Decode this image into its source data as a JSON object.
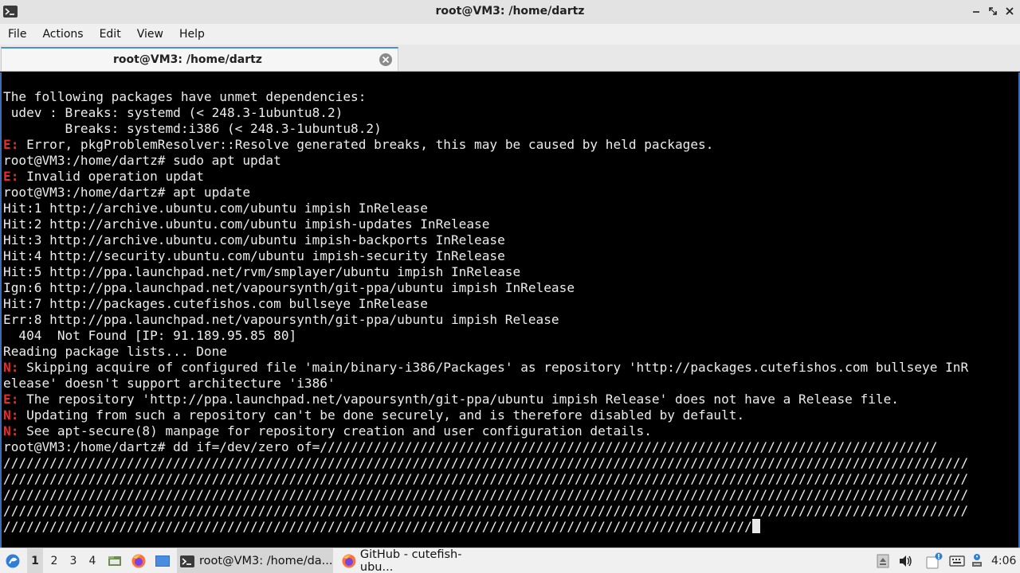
{
  "window": {
    "title": "root@VM3: /home/dartz"
  },
  "menu": {
    "items": [
      "File",
      "Actions",
      "Edit",
      "View",
      "Help"
    ]
  },
  "tab": {
    "label": "root@VM3: /home/dartz"
  },
  "terminal": {
    "lines": [
      {
        "pfx": "",
        "text": "The following packages have unmet dependencies:"
      },
      {
        "pfx": "",
        "text": " udev : Breaks: systemd (< 248.3-1ubuntu8.2)"
      },
      {
        "pfx": "",
        "text": "        Breaks: systemd:i386 (< 248.3-1ubuntu8.2)"
      },
      {
        "pfx": "E:",
        "text": " Error, pkgProblemResolver::Resolve generated breaks, this may be caused by held packages."
      },
      {
        "pfx": "",
        "text": "root@VM3:/home/dartz# sudo apt updat"
      },
      {
        "pfx": "E:",
        "text": " Invalid operation updat"
      },
      {
        "pfx": "",
        "text": "root@VM3:/home/dartz# apt update"
      },
      {
        "pfx": "",
        "text": "Hit:1 http://archive.ubuntu.com/ubuntu impish InRelease"
      },
      {
        "pfx": "",
        "text": "Hit:2 http://archive.ubuntu.com/ubuntu impish-updates InRelease"
      },
      {
        "pfx": "",
        "text": "Hit:3 http://archive.ubuntu.com/ubuntu impish-backports InRelease"
      },
      {
        "pfx": "",
        "text": "Hit:4 http://security.ubuntu.com/ubuntu impish-security InRelease"
      },
      {
        "pfx": "",
        "text": "Hit:5 http://ppa.launchpad.net/rvm/smplayer/ubuntu impish InRelease"
      },
      {
        "pfx": "",
        "text": "Ign:6 http://ppa.launchpad.net/vapoursynth/git-ppa/ubuntu impish InRelease"
      },
      {
        "pfx": "",
        "text": "Hit:7 http://packages.cutefishos.com bullseye InRelease"
      },
      {
        "pfx": "",
        "text": "Err:8 http://ppa.launchpad.net/vapoursynth/git-ppa/ubuntu impish Release"
      },
      {
        "pfx": "",
        "text": "  404  Not Found [IP: 91.189.95.85 80]"
      },
      {
        "pfx": "",
        "text": "Reading package lists... Done"
      },
      {
        "pfx": "N:",
        "text": " Skipping acquire of configured file 'main/binary-i386/Packages' as repository 'http://packages.cutefishos.com bullseye InR"
      },
      {
        "pfx": "",
        "text": "elease' doesn't support architecture 'i386'"
      },
      {
        "pfx": "E:",
        "text": " The repository 'http://ppa.launchpad.net/vapoursynth/git-ppa/ubuntu impish Release' does not have a Release file."
      },
      {
        "pfx": "N:",
        "text": " Updating from such a repository can't be done securely, and is therefore disabled by default."
      },
      {
        "pfx": "N:",
        "text": " See apt-secure(8) manpage for repository creation and user configuration details."
      },
      {
        "pfx": "",
        "text": "root@VM3:/home/dartz# dd if=/dev/zero of=////////////////////////////////////////////////////////////////////////////////"
      },
      {
        "pfx": "",
        "text": "/////////////////////////////////////////////////////////////////////////////////////////////////////////////////////////////"
      },
      {
        "pfx": "",
        "text": "/////////////////////////////////////////////////////////////////////////////////////////////////////////////////////////////"
      },
      {
        "pfx": "",
        "text": "/////////////////////////////////////////////////////////////////////////////////////////////////////////////////////////////"
      },
      {
        "pfx": "",
        "text": "/////////////////////////////////////////////////////////////////////////////////////////////////////////////////////////////"
      },
      {
        "pfx": "",
        "text": "/////////////////////////////////////////////////////////////////////////////////////////////////",
        "cursor": true
      }
    ]
  },
  "taskbar": {
    "workspaces": [
      "1",
      "2",
      "3",
      "4"
    ],
    "active_workspace": "1",
    "tasks": [
      {
        "label": "root@VM3: /home/da...",
        "icon": "terminal-icon"
      },
      {
        "label": "GitHub - cutefish-ubu...",
        "icon": "firefox-icon"
      }
    ],
    "clock": "4:06"
  }
}
